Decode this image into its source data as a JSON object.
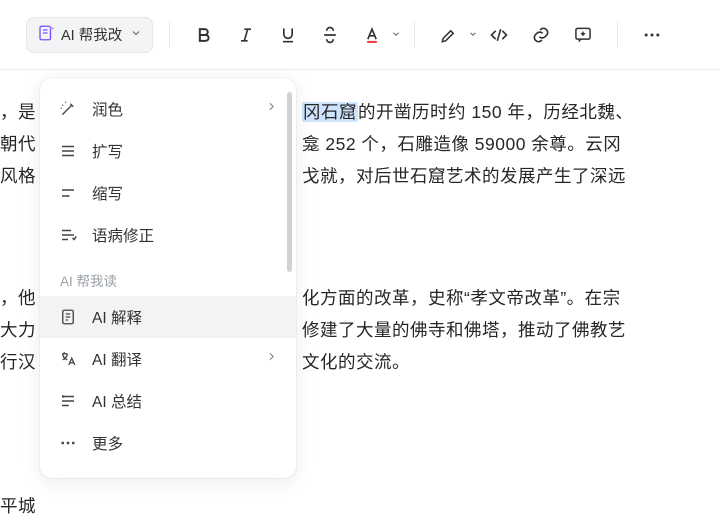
{
  "toolbar": {
    "ai_button_label": "AI 帮我改"
  },
  "menu": {
    "write_section": "",
    "polish": "润色",
    "expand": "扩写",
    "shorten": "缩写",
    "grammar": "语病修正",
    "read_section": "AI 帮我读",
    "explain": "AI 解释",
    "translate": "AI 翻译",
    "summarize": "AI 总结",
    "more": "更多"
  },
  "doc": {
    "l1a": "，是",
    "l1b_hl": "冈石窟",
    "l1c": "的开凿历时约 150 年，历经北魏、",
    "l2a": "朝代",
    "l2b": "龛 252 个，石雕造像 59000 余尊。云冈",
    "l3a": "风格",
    "l3b": "戈就，对后世石窟艺术的发展产生了深远",
    "l4a": "，他",
    "l4b": "化方面的改革，史称“孝文帝改革”。在宗",
    "l5a": "大力",
    "l5b": "修建了大量的佛寺和佛塔，推动了佛教艺",
    "l6a": "行汉",
    "l6b": "文化的交流。",
    "l7a": "平城"
  }
}
